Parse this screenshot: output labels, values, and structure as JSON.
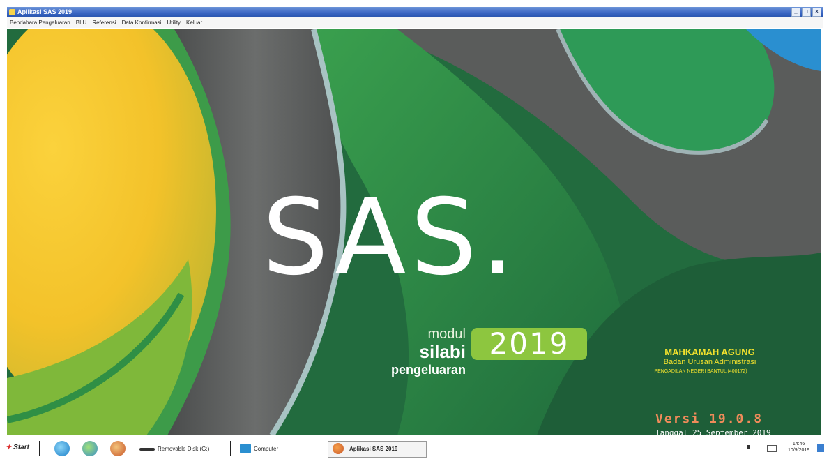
{
  "window": {
    "title": "Aplikasi SAS 2019",
    "controls": [
      "_",
      "□",
      "×"
    ]
  },
  "menu": {
    "items": [
      "Bendahara Pengeluaran",
      "BLU",
      "Referensi",
      "Data Konfirmasi",
      "Utility",
      "Keluar"
    ]
  },
  "splash": {
    "logo": "SAS.",
    "modul": "modul",
    "silabi": "silabi",
    "pengeluaran": "pengeluaran",
    "year": "2019",
    "org_title": "MAHKAMAH AGUNG",
    "org_sub": "Badan Urusan Administrasi",
    "org_unit": "PENGADILAN NEGERI BANTUL (400172)",
    "version": "Versi 19.0.8",
    "date": "Tanggal 25 September 2019"
  },
  "taskbar": {
    "start": "Start",
    "removable_disk": "Removable Disk (G:)",
    "computer": "Computer",
    "active_app": "Aplikasi SAS 2019",
    "time": "14:46",
    "date": "10/9/2019"
  },
  "colors": {
    "green_dark": "#215e3a",
    "green_mid": "#2e8b4e",
    "yellow": "#f6c62e",
    "gray": "#5e6060",
    "badge": "#8dc63f",
    "org_text": "#f2e12d",
    "version_text": "#ef8b5a"
  },
  "icons": [
    "start-icon",
    "ie-icon",
    "explorer-icon",
    "media-icon",
    "removable-disk-icon",
    "computer-icon",
    "sas-app-icon",
    "speaker-icon",
    "network-icon"
  ]
}
